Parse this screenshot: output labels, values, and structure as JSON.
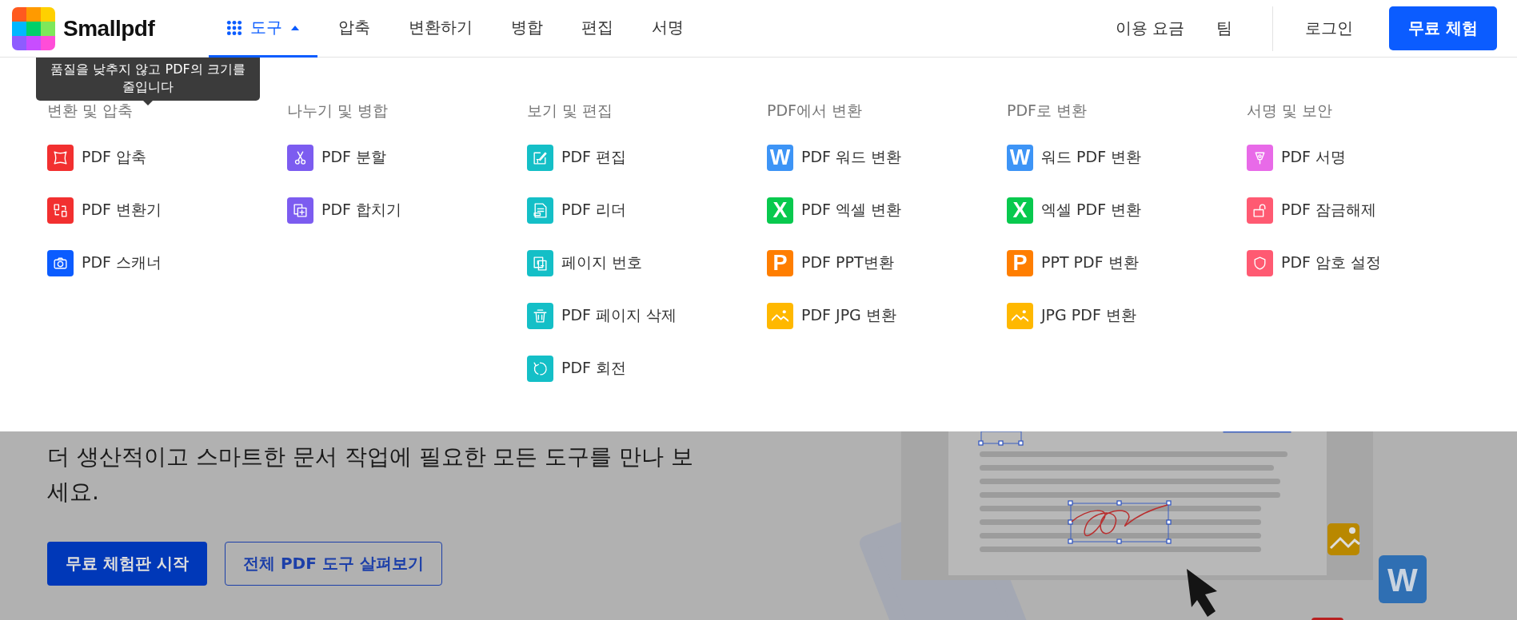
{
  "header": {
    "brand": "Smallpdf",
    "nav": [
      {
        "label": "도구",
        "selected": true,
        "expanded": true,
        "kind": "menu"
      },
      {
        "label": "압축",
        "selected": false,
        "kind": "link"
      },
      {
        "label": "변환하기",
        "selected": false,
        "kind": "link"
      },
      {
        "label": "병합",
        "selected": false,
        "kind": "link"
      },
      {
        "label": "편집",
        "selected": false,
        "kind": "link"
      },
      {
        "label": "서명",
        "selected": false,
        "kind": "link"
      }
    ],
    "right_links": [
      "이용 요금",
      "팀"
    ],
    "login": "로그인",
    "cta": "무료 체험"
  },
  "tooltip": "품질을 낮추지 않고 PDF의 크기를 줄입니다",
  "menu": [
    {
      "heading": "변환 및 압축",
      "items": [
        {
          "label": "PDF 압축",
          "kind": "compress",
          "color": "#f23030"
        },
        {
          "label": "PDF 변환기",
          "kind": "convert",
          "color": "#f23030"
        },
        {
          "label": "PDF 스캐너",
          "kind": "scan",
          "color": "#0b5cff"
        }
      ]
    },
    {
      "heading": "나누기 및 병합",
      "items": [
        {
          "label": "PDF 분할",
          "kind": "split",
          "color": "#7c5cf0"
        },
        {
          "label": "PDF 합치기",
          "kind": "merge",
          "color": "#7c5cf0"
        }
      ]
    },
    {
      "heading": "보기 및 편집",
      "items": [
        {
          "label": "PDF 편집",
          "kind": "edit",
          "color": "#14bfc7"
        },
        {
          "label": "PDF 리더",
          "kind": "reader",
          "color": "#14bfc7"
        },
        {
          "label": "페이지 번호",
          "kind": "numbers",
          "color": "#14bfc7"
        },
        {
          "label": "PDF 페이지 삭제",
          "kind": "delete",
          "color": "#14bfc7"
        },
        {
          "label": "PDF 회전",
          "kind": "rotate",
          "color": "#14bfc7"
        }
      ]
    },
    {
      "heading": "PDF에서 변환",
      "items": [
        {
          "label": "PDF 워드 변환",
          "kind": "letter",
          "glyph": "W",
          "color": "#3d94f6"
        },
        {
          "label": "PDF 엑셀 변환",
          "kind": "letter",
          "glyph": "X",
          "color": "#08c94e"
        },
        {
          "label": "PDF PPT변환",
          "kind": "letter",
          "glyph": "P",
          "color": "#ff7e00"
        },
        {
          "label": "PDF JPG 변환",
          "kind": "image",
          "color": "#ffb800"
        }
      ]
    },
    {
      "heading": "PDF로 변환",
      "items": [
        {
          "label": "워드 PDF 변환",
          "kind": "letter",
          "glyph": "W",
          "color": "#3d94f6"
        },
        {
          "label": "엑셀 PDF 변환",
          "kind": "letter",
          "glyph": "X",
          "color": "#08c94e"
        },
        {
          "label": "PPT PDF 변환",
          "kind": "letter",
          "glyph": "P",
          "color": "#ff7e00"
        },
        {
          "label": "JPG PDF 변환",
          "kind": "image",
          "color": "#ffb800"
        }
      ]
    },
    {
      "heading": "서명 및 보안",
      "items": [
        {
          "label": "PDF 서명",
          "kind": "sign",
          "color": "#e86ae8"
        },
        {
          "label": "PDF 잠금해제",
          "kind": "unlock",
          "color": "#ff5a72"
        },
        {
          "label": "PDF 암호 설정",
          "kind": "protect",
          "color": "#ff5a72"
        }
      ]
    }
  ],
  "hero": {
    "text": "더 생산적이고 스마트한 문서 작업에 필요한 모든 도구를 만나 보세요.",
    "primary": "무료 체험판 시작",
    "secondary": "전체 PDF 도구 살펴보기",
    "badge_glyph": "W"
  }
}
